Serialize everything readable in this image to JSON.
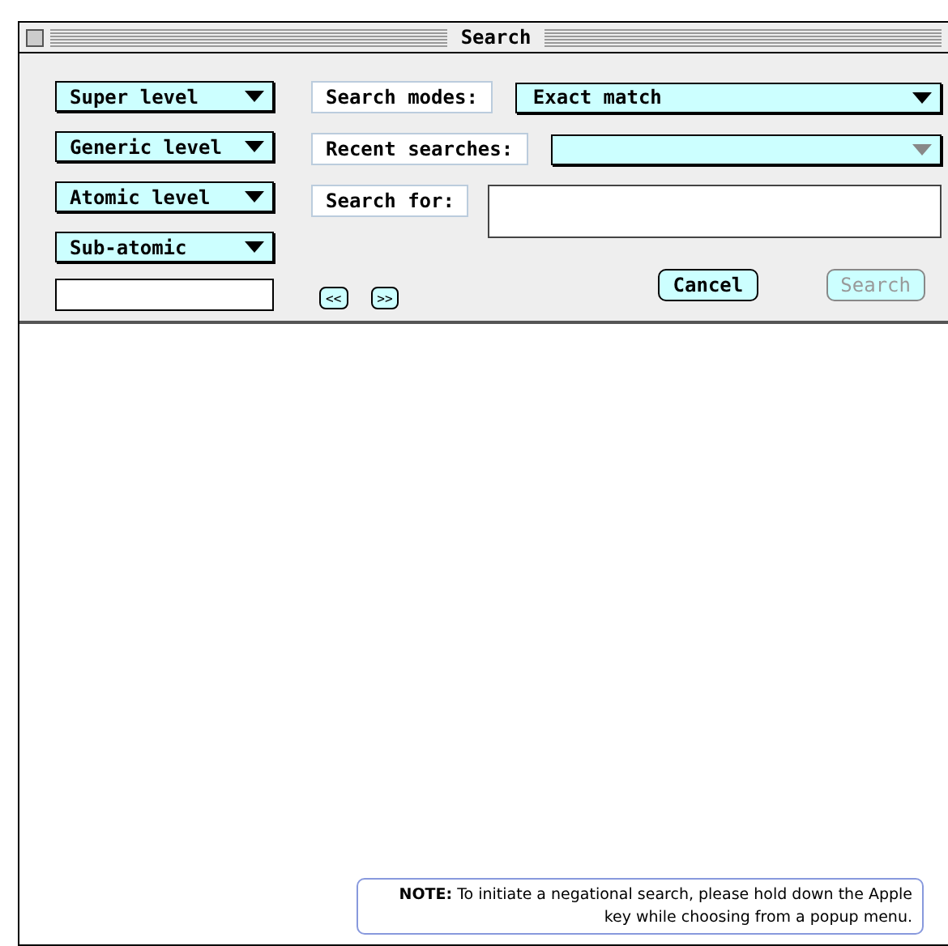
{
  "window": {
    "title": "Search"
  },
  "level_popups": [
    {
      "label": "Super level"
    },
    {
      "label": "Generic level"
    },
    {
      "label": "Atomic level"
    },
    {
      "label": "Sub-atomic"
    }
  ],
  "search_modes": {
    "label": "Search modes:",
    "value": "Exact match",
    "disabled": false
  },
  "recent_searches": {
    "label": "Recent searches:",
    "disabled": true
  },
  "search_for": {
    "label": "Search for:"
  },
  "nav_buttons": [
    {
      "label": "<<"
    },
    {
      "label": ">>"
    }
  ],
  "buttons": [
    {
      "label": "Cancel",
      "disabled": false
    },
    {
      "label": "Search",
      "disabled": true
    }
  ],
  "note": "**NOTE:** To initiate a negational search, please hold down the Apple key while choosing from a popup menu."
}
